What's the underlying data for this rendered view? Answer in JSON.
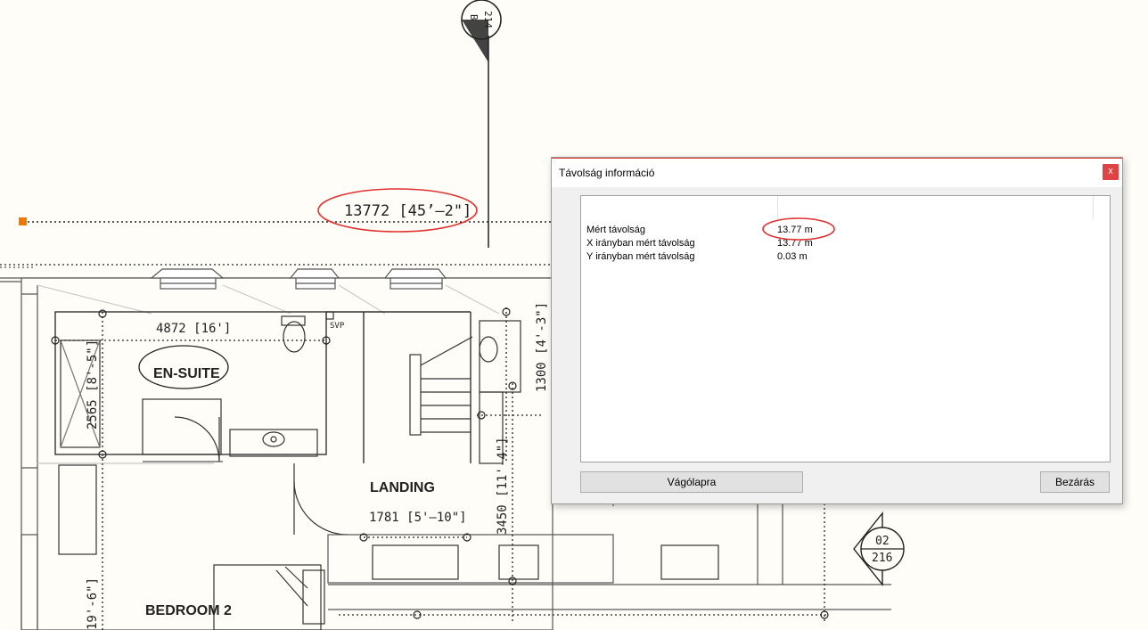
{
  "drawing": {
    "main_dimension": "13772 [45’–2\"]",
    "ensuite_dimension": "4872 [16']",
    "ensuite_label": "EN-SUITE",
    "landing_label": "LANDING",
    "landing_dimension": "1781 [5'–10\"]",
    "bedroom_label": "BEDROOM 2",
    "left_dimension": "2565 [8'-5\"]",
    "left_dimension_lower": "19'-6\"]",
    "right_dimension_1300": "1300 [4'-3\"]",
    "right_dimension_3450": "3450 [11'-4\"]",
    "svp_label": "SVP",
    "section_marker_top": {
      "top": "214",
      "bottom": "B"
    },
    "section_marker_right": {
      "top": "02",
      "bottom": "216"
    }
  },
  "dialog": {
    "title": "Távolság információ",
    "close_label": "x",
    "rows": [
      {
        "label": "Mért távolság",
        "value": "13.77 m"
      },
      {
        "label": "X irányban mért távolság",
        "value": "13.77 m"
      },
      {
        "label": "Y irányban mért távolság",
        "value": "0.03 m"
      }
    ],
    "copy_button": "Vágólapra",
    "close_button": "Bezárás"
  },
  "colors": {
    "annotation_red": "#e03030",
    "background": "#fffdf7",
    "marker_orange": "#f07800"
  }
}
